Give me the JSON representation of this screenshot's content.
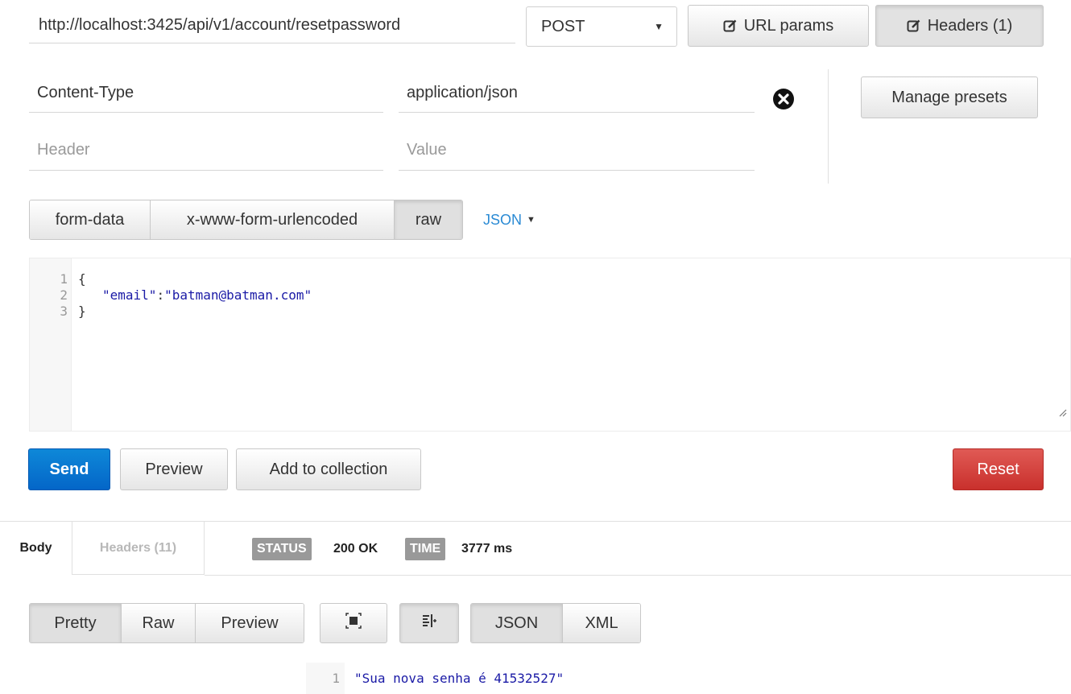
{
  "request": {
    "url": "http://localhost:3425/api/v1/account/resetpassword",
    "method": "POST",
    "url_params_label": "URL params",
    "headers_label": "Headers (1)"
  },
  "headers": {
    "rows": [
      {
        "key": "Content-Type",
        "value": "application/json"
      }
    ],
    "new_key_placeholder": "Header",
    "new_value_placeholder": "Value",
    "manage_presets_label": "Manage presets"
  },
  "body_modes": {
    "items": [
      "form-data",
      "x-www-form-urlencoded",
      "raw"
    ],
    "active": "raw",
    "format_label": "JSON"
  },
  "editor": {
    "line_numbers": [
      "1",
      "2",
      "3"
    ],
    "lines": [
      {
        "parts": [
          {
            "t": "pun",
            "v": "{"
          }
        ]
      },
      {
        "parts": [
          {
            "t": "str",
            "v": "\"email\""
          },
          {
            "t": "pun",
            "v": ":"
          },
          {
            "t": "str",
            "v": "\"batman@batman.com\""
          }
        ]
      },
      {
        "parts": [
          {
            "t": "pun",
            "v": "}"
          }
        ]
      }
    ]
  },
  "actions": {
    "send_label": "Send",
    "preview_label": "Preview",
    "add_to_collection_label": "Add to collection",
    "reset_label": "Reset"
  },
  "response": {
    "tab_body": "Body",
    "tab_headers": "Headers (11)",
    "status_label": "STATUS",
    "status_value": "200 OK",
    "time_label": "TIME",
    "time_value": "3777 ms",
    "view_modes": [
      "Pretty",
      "Raw",
      "Preview"
    ],
    "active_view": "Pretty",
    "formats": [
      "JSON",
      "XML"
    ],
    "active_format": "JSON",
    "line_number": "1",
    "line_text": "\"Sua nova senha é 41532527\""
  },
  "colors": {
    "accent_link": "#2a8ad4",
    "send_blue": "#0466c8",
    "reset_red": "#c9302c",
    "string_blue": "#1a1aa6"
  }
}
